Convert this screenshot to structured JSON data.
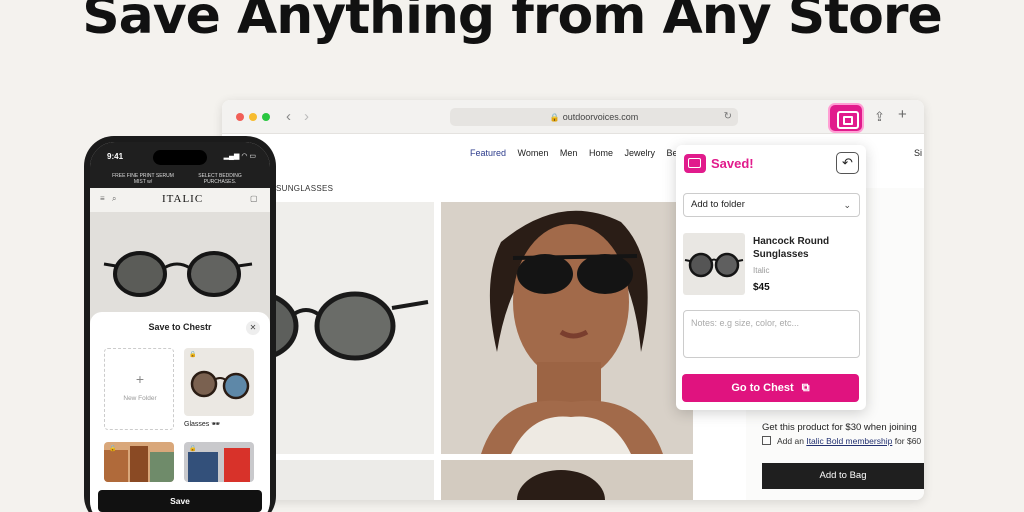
{
  "headline": "Save Anything from Any Store",
  "browser": {
    "url": "outdoorvoices.com",
    "nav": [
      "Featured",
      "Women",
      "Men",
      "Home",
      "Jewelry",
      "Bea"
    ],
    "signin": "Si",
    "breadcrumb": "SUNGLASSES",
    "promo": "Get this product for $30 when joining",
    "membership_prefix": "Add an",
    "membership_link": "Italic Bold membership",
    "membership_suffix": "for $60",
    "add_to_bag": "Add to Bag"
  },
  "popup": {
    "title": "Saved!",
    "folder_select": "Add to folder",
    "product_name": "Hancock Round Sunglasses",
    "product_brand": "Italic",
    "product_price": "$45",
    "notes_placeholder": "Notes: e.g size, color, etc...",
    "go_button": "Go to Chest",
    "colors": {
      "accent": "#e0137f"
    }
  },
  "phone": {
    "time": "9:41",
    "banner_left": "FREE FINE PRINT SERUM MIST w/",
    "banner_right": "SELECT BEDDING PURCHASES.",
    "brand": "ITALIC",
    "sheet_title": "Save to Chestr",
    "new_folder": "New Folder",
    "folder_glasses": "Glasses 🕶",
    "save_button": "Save"
  }
}
